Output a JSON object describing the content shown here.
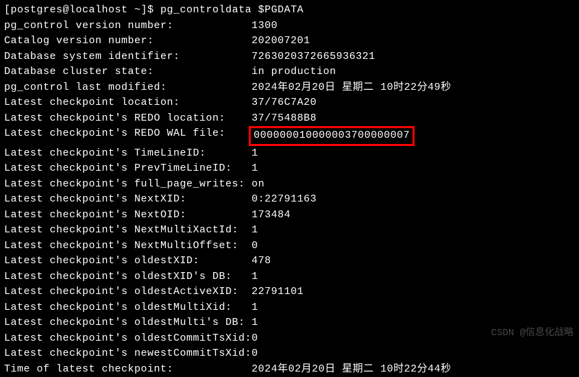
{
  "prompt": {
    "user_host": "[postgres@localhost ~]$ ",
    "command": "pg_controldata $PGDATA"
  },
  "rows": [
    {
      "label": "pg_control version number:            ",
      "value": "1300"
    },
    {
      "label": "Catalog version number:               ",
      "value": "202007201"
    },
    {
      "label": "Database system identifier:           ",
      "value": "7263020372665936321"
    },
    {
      "label": "Database cluster state:               ",
      "value": "in production"
    },
    {
      "label": "pg_control last modified:             ",
      "value": "2024年02月20日 星期二 10时22分49秒"
    },
    {
      "label": "Latest checkpoint location:           ",
      "value": "37/76C7A20"
    },
    {
      "label": "Latest checkpoint's REDO location:    ",
      "value": "37/75488B8"
    },
    {
      "label": "Latest checkpoint's REDO WAL file:    ",
      "value": "000000010000003700000007",
      "highlight": true
    },
    {
      "label": "Latest checkpoint's TimeLineID:       ",
      "value": "1"
    },
    {
      "label": "Latest checkpoint's PrevTimeLineID:   ",
      "value": "1"
    },
    {
      "label": "Latest checkpoint's full_page_writes: ",
      "value": "on"
    },
    {
      "label": "Latest checkpoint's NextXID:          ",
      "value": "0:22791163"
    },
    {
      "label": "Latest checkpoint's NextOID:          ",
      "value": "173484"
    },
    {
      "label": "Latest checkpoint's NextMultiXactId:  ",
      "value": "1"
    },
    {
      "label": "Latest checkpoint's NextMultiOffset:  ",
      "value": "0"
    },
    {
      "label": "Latest checkpoint's oldestXID:        ",
      "value": "478"
    },
    {
      "label": "Latest checkpoint's oldestXID's DB:   ",
      "value": "1"
    },
    {
      "label": "Latest checkpoint's oldestActiveXID:  ",
      "value": "22791101"
    },
    {
      "label": "Latest checkpoint's oldestMultiXid:   ",
      "value": "1"
    },
    {
      "label": "Latest checkpoint's oldestMulti's DB: ",
      "value": "1"
    },
    {
      "label": "Latest checkpoint's oldestCommitTsXid:",
      "value": "0"
    },
    {
      "label": "Latest checkpoint's newestCommitTsXid:",
      "value": "0"
    },
    {
      "label": "Time of latest checkpoint:            ",
      "value": "2024年02月20日 星期二 10时22分44秒"
    }
  ],
  "watermark": "CSDN @信息化战略"
}
